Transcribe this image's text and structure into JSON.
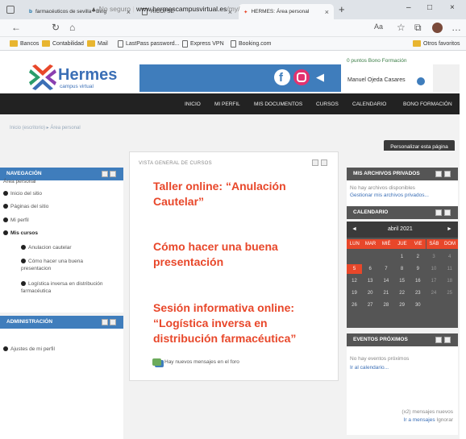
{
  "tabs": [
    {
      "label": "farmacéuticos de sevilla - Bing",
      "close": "×"
    },
    {
      "label": "RICOFSE",
      "close": "×"
    },
    {
      "label": "HERMES: Área personal",
      "close": "×",
      "active": true
    }
  ],
  "new_tab": "+",
  "window": {
    "minimize": "–",
    "maximize": "□",
    "close": "×"
  },
  "address": {
    "insecure": "No seguro",
    "host": "www.hermescampusvirtual.es",
    "path": "/my/"
  },
  "bookmarks": [
    "Bancos",
    "Contabilidad",
    "Mail",
    "LastPass password...",
    "Express VPN",
    "Booking.com"
  ],
  "other_favorites": "Otros favoritos",
  "logo": {
    "name": "Hermes",
    "sub": "campus virtual"
  },
  "user": {
    "bono": "0 puntos Bono Formación",
    "name": "Manuel Ojeda Casares"
  },
  "menu": [
    "INICIO",
    "MI PERFIL",
    "MIS DOCUMENTOS",
    "CURSOS",
    "CALENDARIO",
    "BONO FORMACIÓN"
  ],
  "breadcrumb": "Inicio (escritorio) ▸ Área personal",
  "customize": "Personalizar esta página",
  "navigation": {
    "title": "NAVEGACIÓN",
    "items": [
      "Área personal",
      "Inicio del sitio",
      "Páginas del sitio",
      "Mi perfil",
      "Mis cursos",
      "Anulacion cautelar",
      "Cómo hacer una buena presentacion",
      "Logística inversa en distribución farmacéutica"
    ]
  },
  "admin": {
    "title": "ADMINISTRACIÓN",
    "items": [
      "Ajustes de mi perfil"
    ]
  },
  "center": {
    "title": "VISTA GENERAL DE CURSOS",
    "courses": [
      "Taller online: “Anulación Cautelar”",
      "Cómo hacer una buena presentación",
      "Sesión informativa online: “Logística inversa en distribución farmacéutica”"
    ],
    "forum": "Hay nuevos mensajes en el foro"
  },
  "private_files": {
    "title": "MIS ARCHIVOS PRIVADOS",
    "empty": "No hay archivos disponibles",
    "manage": "Gestionar mis archivos privados..."
  },
  "calendar": {
    "title": "CALENDARIO",
    "month": "abril 2021",
    "prev": "◄",
    "next": "►",
    "days": [
      "LUN",
      "MAR",
      "MIÉ",
      "JUE",
      "VIE",
      "SÁB",
      "DOM"
    ],
    "dates": [
      "",
      "",
      "",
      "1",
      "2",
      "3",
      "4",
      "5",
      "6",
      "7",
      "8",
      "9",
      "10",
      "11",
      "12",
      "13",
      "14",
      "15",
      "16",
      "17",
      "18",
      "19",
      "20",
      "21",
      "22",
      "23",
      "24",
      "25",
      "26",
      "27",
      "28",
      "29",
      "30",
      "",
      ""
    ]
  },
  "events": {
    "title": "EVENTOS PRÓXIMOS",
    "empty": "No hay eventos próximos",
    "link": "Ir al calendario..."
  },
  "messages": {
    "count": "(x2) mensajes nuevos",
    "link": "Ir a mensajes",
    "ignore": "Ignorar"
  },
  "colors": {
    "accent": "#3f7dbc",
    "course": "#e8472a",
    "menu": "#222222"
  }
}
